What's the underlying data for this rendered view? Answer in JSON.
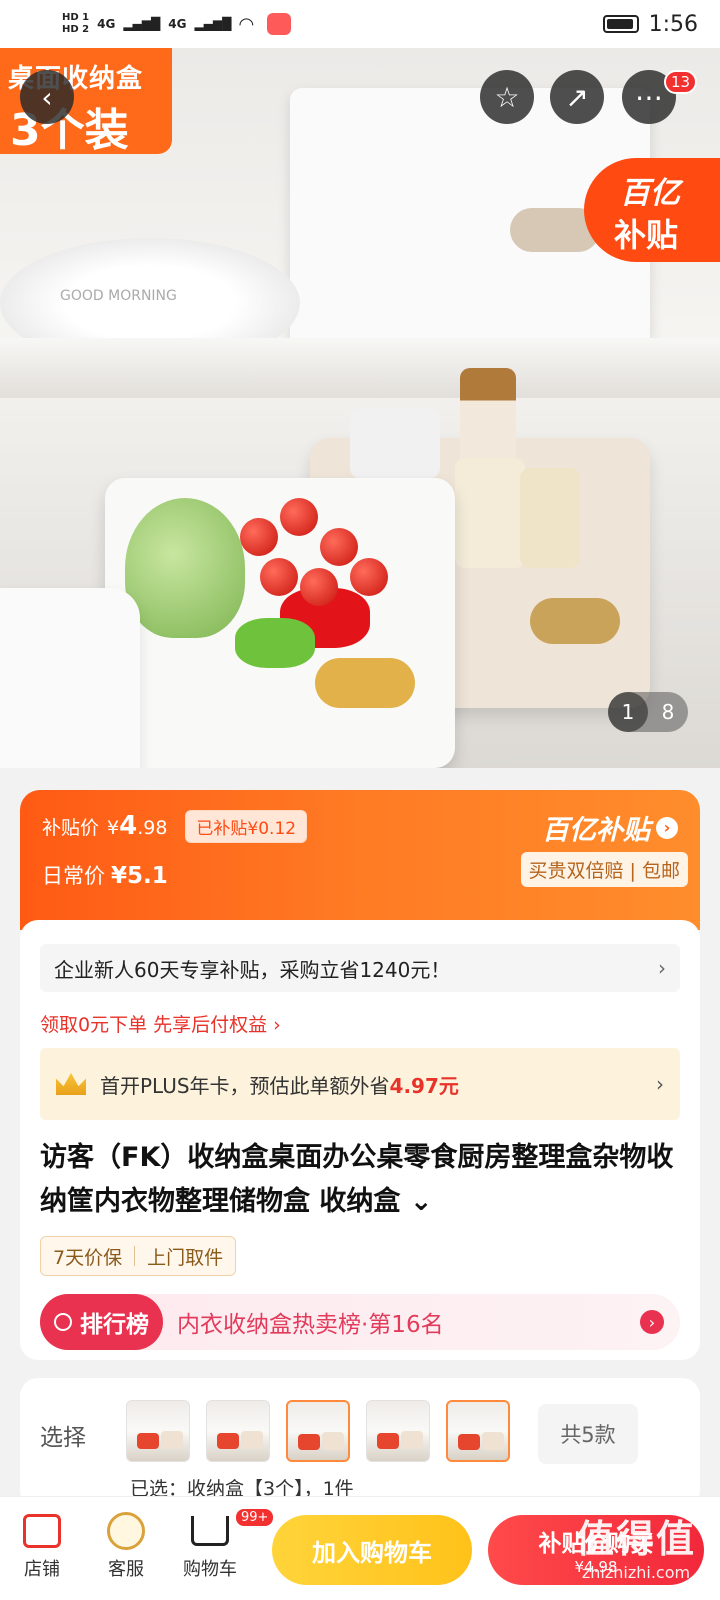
{
  "status_bar": {
    "hd1": "HD 1",
    "hd2": "HD 2",
    "signal1": "4G",
    "signal2": "4G",
    "time": "1:56"
  },
  "hero": {
    "badge_line1": "桌面收纳盒",
    "badge_line2": "3个装",
    "plate_text": "GOOD MORNING",
    "back_icon": "chevron-left-icon",
    "favorite_icon": "star-icon",
    "share_icon": "share-icon",
    "more_icon": "more-dots-icon",
    "more_badge": "13",
    "subsidy_line1": "百亿",
    "subsidy_line2": "补贴",
    "pager_current": "1",
    "pager_total": "8"
  },
  "price": {
    "subsidy_label": "补贴价",
    "currency": "¥",
    "price_int": "4",
    "price_dec": ".98",
    "saved_tag": "已补贴¥0.12",
    "regular_label": "日常价",
    "regular_price": "¥5.1",
    "brand": "百亿补贴",
    "brand_arrow": "›",
    "guarantee": "买贵双倍赔 | 包邮"
  },
  "main": {
    "enterprise_text": "企业新人60天专享补贴，采购立省1240元！",
    "paylater_text": "领取0元下单 先享后付权益 ›",
    "plus_text": "首开PLUS年卡，预估此单额外省",
    "plus_amount": "4.97元",
    "title": "访客（FK）收纳盒桌面办公桌零食厨房整理盒杂物收纳筐内衣物整理储物盒 收纳盒",
    "title_toggle": "⌄",
    "guarantee_1": "7天价保",
    "guarantee_2": "上门取件",
    "rank_badge": "排行榜",
    "rank_text": "内衣收纳盒热卖榜·第16名"
  },
  "select": {
    "label": "选择",
    "count_chip": "共5款",
    "peek_text": "已选：收纳盒【3个】，1件"
  },
  "bottom_bar": {
    "store": "店铺",
    "service": "客服",
    "cart": "购物车",
    "cart_badge": "99+",
    "add_cart": "加入购物车",
    "buy_label": "补贴价购买",
    "buy_price": "¥4.98"
  },
  "watermark": {
    "main": "值得值",
    "url": "zhizhizhi.com"
  },
  "colors": {
    "accent_orange": "#ff5a14",
    "accent_red": "#e8322a",
    "cart_yellow": "#ffc21a"
  }
}
